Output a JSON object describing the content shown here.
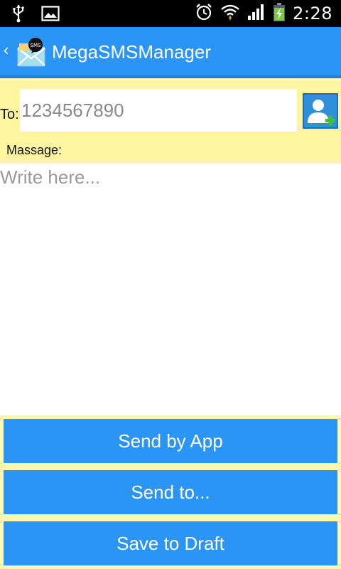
{
  "status_bar": {
    "time": "2:28",
    "icons": [
      "usb-icon",
      "image-icon",
      "alarm-icon",
      "wifi-icon",
      "signal-icon",
      "battery-charging-icon"
    ]
  },
  "action_bar": {
    "title": "MegaSMSManager",
    "accent_color": "#2a95f5"
  },
  "compose": {
    "to_label": "To:",
    "to_value": "1234567890",
    "message_label": "Massage:",
    "message_placeholder": "Write here...",
    "header_color": "#fff5a0"
  },
  "buttons": {
    "send_by_app": "Send by App",
    "send_to": "Send to...",
    "save_to_draft": "Save to Draft"
  }
}
